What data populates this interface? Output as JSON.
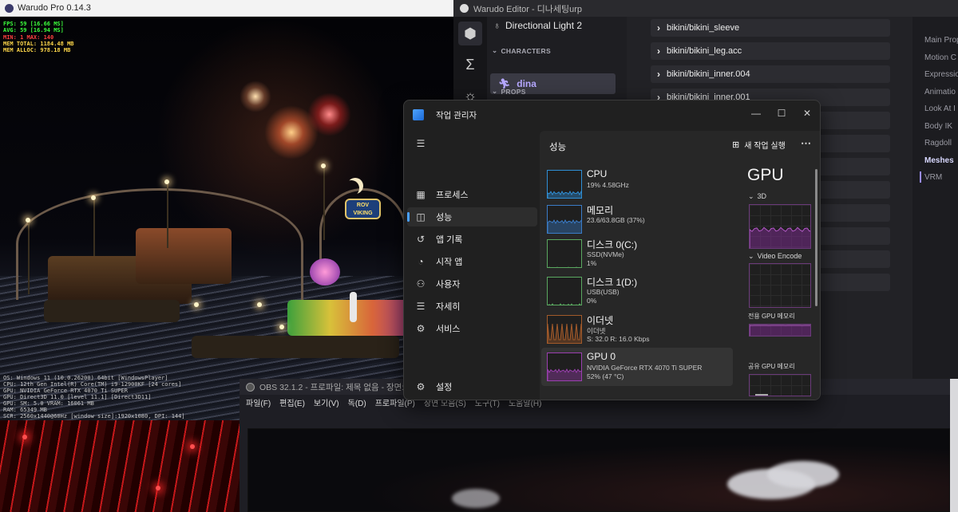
{
  "warudo_pro": {
    "title": "Warudo Pro 0.14.3",
    "stats": [
      {
        "text": "FPS: 59 [16.66 MS]",
        "color": "#3cff3c"
      },
      {
        "text": "AVG: 59 [16.94 MS]",
        "color": "#3cff3c"
      },
      {
        "text": "MIN: 1 MAX: 140",
        "color": "#ff4040"
      },
      {
        "text": "MEM TOTAL: 1184.48 MB",
        "color": "#ffd84a"
      },
      {
        "text": "MEM ALLOC: 978.18 MB",
        "color": "#ffd84a"
      }
    ],
    "sys_info": [
      "OS: Windows 11 (10.0.26200) 64bit [WindowsPlayer]",
      "CPU: 12th Gen Intel(R) Core(TM) i9-12900KF [24 cores]",
      "GPU: NVIDIA GeForce RTX 4070 Ti SUPER",
      "GPU: Direct3D 11.0 [level 11.1] [Direct3D11]",
      "GPU: SM: 5.0  VRAM: 16061 MB",
      "RAM: 65349 MB",
      "SCR: 2560x1440@60Hz [window size]:1920x1080, DPI: 144]"
    ],
    "signage": [
      "ROV",
      "VIKING"
    ]
  },
  "warudo_editor": {
    "title": "Warudo Editor - 디나세팅urp",
    "scene_items": {
      "light": "Directional Light 2",
      "characters_header": "CHARACTERS",
      "character": "dina",
      "props_header": "PROPS"
    },
    "mesh_rows": [
      "bikini/bikini_sleeve",
      "bikini/bikini_leg.acc",
      "bikini/bikini_inner.004",
      "bikini/bikini_inner.001"
    ],
    "nav": [
      "Main Prop",
      "Motion C",
      "Expressio",
      "Animatio",
      "Look At I",
      "Body IK",
      "Ragdoll",
      "Meshes",
      "VRM"
    ],
    "nav_active": "Meshes"
  },
  "obs": {
    "title": "OBS 32.1.2 - 프로파일: 제목 없음 - 장면: 제목 없음",
    "menu": [
      "파일(F)",
      "편집(E)",
      "보기(V)",
      "독(D)",
      "프로파일(P)",
      "장면 모음(S)",
      "도구(T)",
      "도움말(H)"
    ]
  },
  "task_manager": {
    "title": "작업 관리자",
    "sidebar": [
      {
        "label": "프로세스",
        "icon": "processes-icon",
        "glyph": "▦"
      },
      {
        "label": "성능",
        "icon": "performance-icon",
        "glyph": "◫",
        "active": true
      },
      {
        "label": "앱 기록",
        "icon": "app-history-icon",
        "glyph": "↺"
      },
      {
        "label": "시작 앱",
        "icon": "startup-apps-icon",
        "glyph": "◔"
      },
      {
        "label": "사용자",
        "icon": "users-icon",
        "glyph": "⚇"
      },
      {
        "label": "자세히",
        "icon": "details-icon",
        "glyph": "☰"
      },
      {
        "label": "서비스",
        "icon": "services-icon",
        "glyph": "⚙"
      }
    ],
    "settings_label": "설정",
    "content_title": "성능",
    "run_task_label": "새 작업 실행",
    "perf_items": [
      {
        "name": "CPU",
        "sub": [
          "19%  4.58GHz"
        ],
        "graph_color": "#2f8fd6"
      },
      {
        "name": "메모리",
        "sub": [
          "23.6/63.8GB (37%)"
        ],
        "graph_color": "#3a7cc8"
      },
      {
        "name": "디스크 0(C:)",
        "sub": [
          "SSD(NVMe)",
          "1%"
        ],
        "graph_color": "#5aa860"
      },
      {
        "name": "디스크 1(D:)",
        "sub": [
          "USB(USB)",
          "0%"
        ],
        "graph_color": "#5aa860"
      },
      {
        "name": "이더넷",
        "sub": [
          "이더넷",
          "S: 32.0  R: 16.0 Kbps"
        ],
        "graph_color": "#a25a2a"
      },
      {
        "name": "GPU 0",
        "sub": [
          "NVIDIA GeForce RTX 4070 Ti SUPER",
          "52% (47 °C)"
        ],
        "graph_color": "#9b3fb0",
        "active": true
      }
    ],
    "gpu_panel": {
      "title": "GPU",
      "graphs": [
        "3D",
        "Video Encode",
        "전용 GPU 메모리",
        "공유 GPU 메모리"
      ]
    }
  }
}
